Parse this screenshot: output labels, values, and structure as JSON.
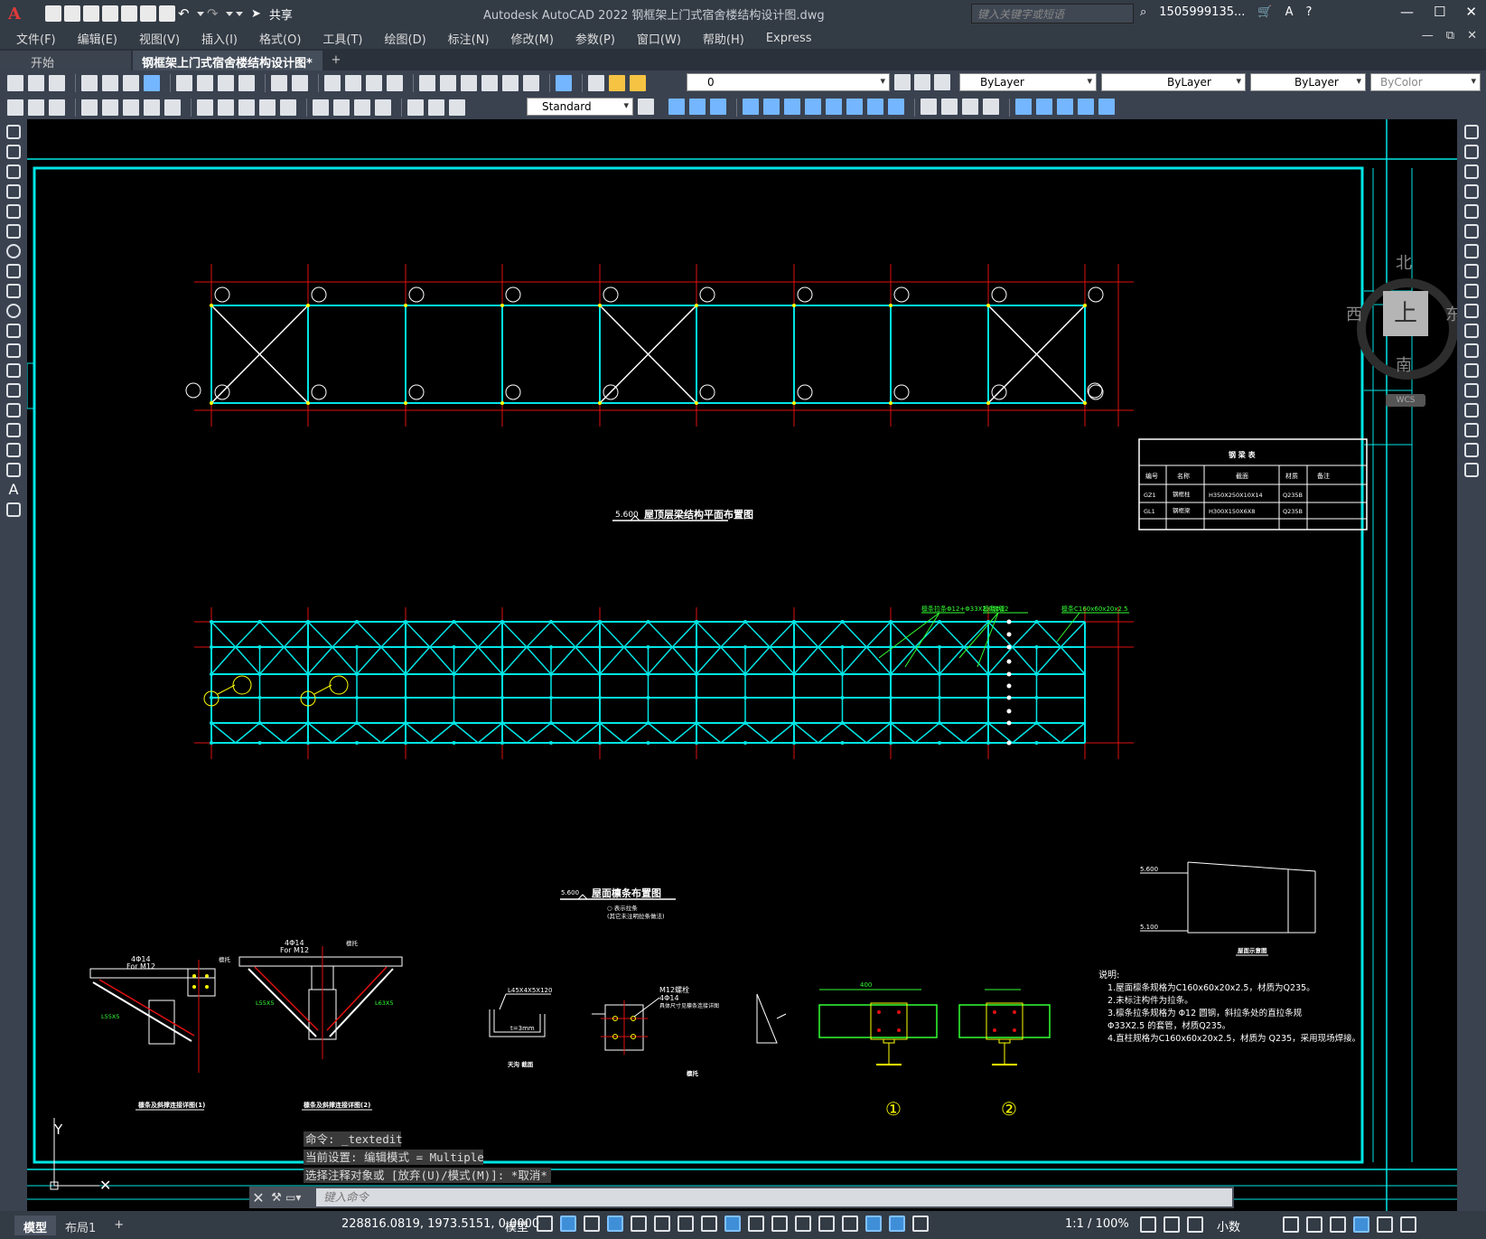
{
  "titlebar": {
    "app_logo": "A",
    "share_label": "共享",
    "title": "Autodesk AutoCAD 2022    钢框架上门式宿舍楼结构设计图.dwg",
    "search_placeholder": "键入关键字或短语",
    "user": "1505999135...",
    "win_min": "—",
    "win_max": "☐",
    "win_close": "✕"
  },
  "menu": {
    "items": [
      "文件(F)",
      "编辑(E)",
      "视图(V)",
      "插入(I)",
      "格式(O)",
      "工具(T)",
      "绘图(D)",
      "标注(N)",
      "修改(M)",
      "参数(P)",
      "窗口(W)",
      "帮助(H)",
      "Express"
    ],
    "right_controls": [
      "—",
      "⧉",
      "✕"
    ]
  },
  "file_tabs": {
    "start": "开始",
    "active": "钢框架上门式宿舍楼结构设计图*",
    "active_close": "✕",
    "plus": "+"
  },
  "toolbar": {
    "layer_value": "0",
    "color_value": "ByLayer",
    "linetype_value": "ByLayer",
    "lineweight_value": "ByLayer",
    "plotstyle_value": "ByColor",
    "textstyle_value": "Standard"
  },
  "viewcube": {
    "north": "北",
    "south": "南",
    "east": "东",
    "west": "西",
    "face": "上",
    "wcs": "WCS"
  },
  "drawing": {
    "plan1_title": "屋顶层梁结构平面布置图",
    "plan1_level": "5.600",
    "plan2_title": "屋面檩条布置图",
    "plan2_level": "5.600",
    "plan2_note1": "○ 表示拉条",
    "plan2_note2": "(其它未注明拉条做法)",
    "table_title": "钢  梁  表",
    "table_headers": [
      "编号",
      "名称",
      "截面",
      "材质",
      "备注"
    ],
    "table_rows": [
      [
        "GZ1",
        "钢框柱",
        "H350X250X10X14",
        "Q235B",
        ""
      ],
      [
        "GL1",
        "钢框梁",
        "H300X150X6X8",
        "Q235B",
        ""
      ]
    ],
    "leader1": "檩条拉条Φ12+Φ33X2.0套管",
    "leader2": "檩条Φ12",
    "leader3": "檩条C160x60x20x2.5",
    "detail1_caption": "檩条及斜撑连接详图(1)",
    "detail2_caption": "檩条及斜撑连接详图(2)",
    "detail_angle1": "L55X5",
    "detail_angle2": "L63X5",
    "detail_bolt1": "4Φ14",
    "detail_bolt2": "For M12",
    "detail_plate": "檩托",
    "section_label": "L45X4X5X120",
    "section_t": "t=3mm",
    "section_caption": "天沟 截面",
    "bolt_detail1": "M12螺栓",
    "bolt_detail2": "4Φ14",
    "bolt_detail3": "具体尺寸见檩条连接详图",
    "plate_caption": "檩托",
    "elev_top": "5.600",
    "elev_bottom": "5.100",
    "elev_caption": "屋面示意图",
    "circle1": "①",
    "circle2": "②",
    "notes_title": "说明:",
    "notes": [
      "1.屋面檩条规格为C160x60x20x2.5，材质为Q235。",
      "2.未标注构件为拉条。",
      "3.檩条拉条规格为 Φ12 圆钢，斜拉条处的直拉条规",
      "  Φ33X2.5 的套管，材质Q235。",
      "4.直柱规格为C160x60x20x2.5，材质为 Q235，采用现场焊接。"
    ],
    "ucs_y": "Y",
    "ucs_x": "✕"
  },
  "command": {
    "history": [
      "命令: _textedit",
      "当前设置: 编辑模式 = Multiple",
      "选择注释对象或 [放弃(U)/模式(M)]: *取消*"
    ],
    "placeholder": "键入命令"
  },
  "status": {
    "tab_model": "模型",
    "tab_layout": "布局1",
    "tab_plus": "+",
    "coords": "228816.0819, 1973.5151, 0.0000",
    "mode": "模型",
    "scale": "1:1 / 100%",
    "decimal": "小数"
  },
  "colors": {
    "cyan": "#00e5e5",
    "red": "#e01010",
    "white": "#ffffff",
    "green": "#33ff33",
    "yellow": "#ffff00"
  }
}
